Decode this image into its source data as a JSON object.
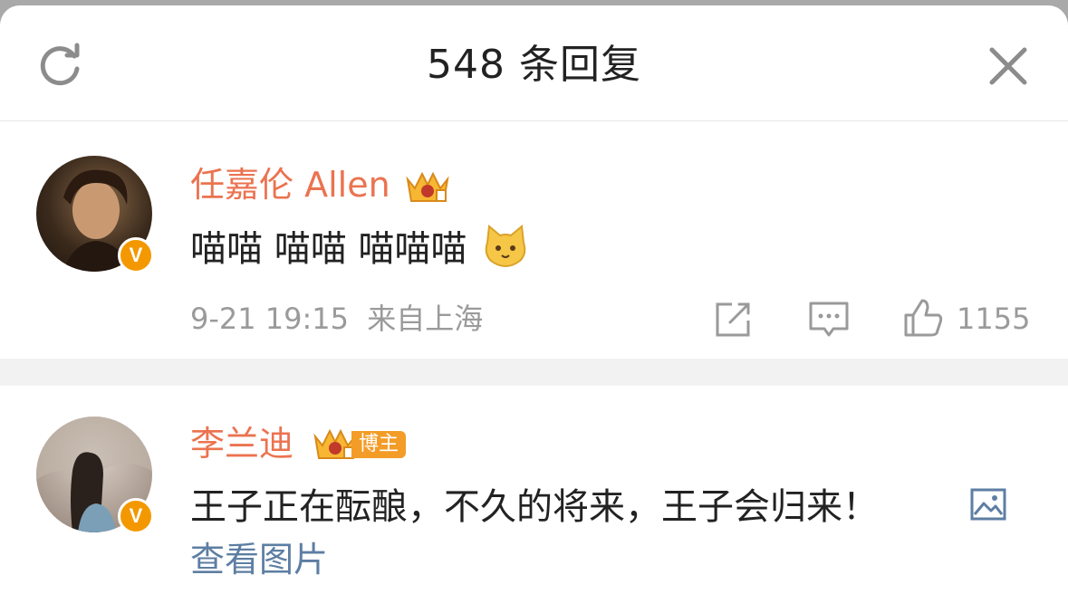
{
  "header": {
    "title": "548 条回复",
    "refresh_icon": "refresh-icon",
    "close_icon": "close-icon"
  },
  "comments": [
    {
      "username": "任嘉伦 Allen",
      "badge_icon": "vip-crown-icon",
      "verified_badge": "V",
      "text": "喵喵 喵喵 喵喵喵",
      "emoji": "cat-emoji",
      "date": "9-21 19:15",
      "location": "来自上海",
      "likes": "1155",
      "actions": [
        "share-icon",
        "comment-icon",
        "like-icon"
      ]
    },
    {
      "username": "李兰迪",
      "badge_icon": "vip-crown-icon",
      "tag": "博主",
      "verified_badge": "V",
      "text": "王子正在酝酿，不久的将来，王子会归来！",
      "image_icon": "picture-icon",
      "view_pictures": "查看图片"
    }
  ],
  "colors": {
    "username": "#eb7350",
    "link": "#5d7ea3",
    "meta": "#9a9a9a",
    "verified": "#f39800",
    "tag": "#f39c27"
  }
}
